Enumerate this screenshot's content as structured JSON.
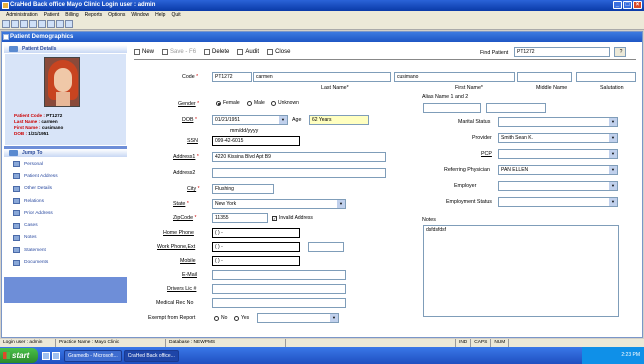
{
  "window": {
    "title": "CraHed Back office    Mayo Clinic    Login user : admin"
  },
  "menu": [
    "Administration",
    "Patient",
    "Billing",
    "Reports",
    "Options",
    "Window",
    "Help",
    "Quit"
  ],
  "subwindow": {
    "title": "Patient Demographics"
  },
  "sidebar": {
    "patient_details_title": "Patient Details",
    "patient": {
      "code_label": "Patient Code : ",
      "code": "PT1272",
      "last_label": "Last Name : ",
      "last": "carmen",
      "first_label": "First Name : ",
      "first": "cusimano",
      "dob_label": "DOB : ",
      "dob": "1/21/1951"
    },
    "jump_title": "Jump To",
    "jump_items": [
      "Personal",
      "Patient Address",
      "Other Details",
      "Relations",
      "Prior Address",
      "Cases",
      "Notes",
      "Statement",
      "Documents"
    ]
  },
  "toolbar": {
    "new": "New",
    "save": "Save - F6",
    "delete": "Delete",
    "audit": "Audit",
    "close": "Close"
  },
  "find": {
    "label": "Find Patient",
    "value": "PT1272",
    "btn": "?"
  },
  "form": {
    "code_label": "Code",
    "code": "PT1272",
    "last_name": "carmen",
    "first_name": "cusimano",
    "middle_name": "",
    "salutation": "",
    "last_name_label": "Last Name*",
    "first_name_label": "First Name*",
    "middle_name_label": "Middle Name",
    "salutation_label": "Salutation",
    "gender_label": "Gender",
    "gender_opts": [
      "Female",
      "Male",
      "Unknown"
    ],
    "dob_label": "DOB",
    "dob": "01/21/1951",
    "dob_hint": "mm/dd/yyyy",
    "age_label": "Age",
    "age": "62 Years",
    "ssn_label": "SSN",
    "ssn": "099-42-6015",
    "address1_label": "Address1",
    "address1": "4220 Kissina Blvd Apt B9",
    "address2_label": "Address2",
    "address2": "",
    "city_label": "City",
    "city": "Flushing",
    "state_label": "State",
    "state": "New York",
    "zip_label": "ZipCode",
    "zip": "11355",
    "invalid_label": "Invalid Address",
    "home_phone_label": "Home Phone",
    "home_phone": "(  )  -",
    "work_phone_label": "Work Phone,Ext",
    "work_phone": "(  )  -",
    "mobile_label": "Mobile",
    "mobile": "(  )  -",
    "email_label": "E-Mail",
    "drivers_label": "Drivers Lic #",
    "medical_label": "Medical Rec No",
    "exempt_label": "Exempt from Report",
    "exempt_opts": [
      "No",
      "Yes"
    ],
    "alias_label": "Alias Name 1 and 2",
    "marital_label": "Marital Status",
    "marital": "",
    "provider_label": "Provider",
    "provider": "Smith Sean K.",
    "pcp_label": "PCP",
    "pcp": "",
    "referring_label": "Referring Physician",
    "referring": "PAN ELLEN",
    "employer_label": "Employer",
    "employer": "",
    "employment_label": "Employment Status",
    "employment": "",
    "notes_label": "Notes",
    "notes": "dsfdsfdsf"
  },
  "status": {
    "login": "Login user : admin",
    "practice": "Practice Name : Mayo Clinic",
    "database_label": "Database :",
    "database": "NEWPMS",
    "ind": "IND",
    "caps": "CAPS",
    "num": "NUM"
  },
  "taskbar": {
    "start": "start",
    "tasks": [
      "Gramedb - Microsoft...",
      "CraHed Back office..."
    ],
    "time": "2:23 PM"
  }
}
